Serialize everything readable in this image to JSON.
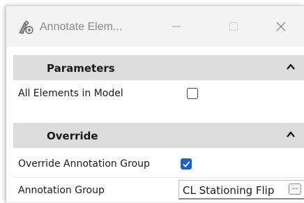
{
  "window": {
    "title": "Annotate Elem...",
    "app_icon": "annotate-tool-icon",
    "controls": {
      "minimize_icon": "minimize-icon",
      "maximize_icon": "maximize-icon",
      "close_icon": "close-icon"
    }
  },
  "sections": {
    "parameters": {
      "title": "Parameters",
      "collapse_icon": "chevron-up-icon",
      "rows": {
        "all_elements": {
          "label": "All Elements in Model",
          "checked": false
        }
      }
    },
    "override": {
      "title": "Override",
      "collapse_icon": "chevron-up-icon",
      "rows": {
        "override_group": {
          "label": "Override Annotation Group",
          "checked": true
        },
        "annotation_group": {
          "label": "Annotation Group",
          "value": "CL Stationing Flip",
          "browse_label": "..."
        }
      }
    }
  },
  "colors": {
    "accent": "#1a62c9",
    "section_header_bg": "#dcdcdc",
    "titlebar_bg": "#f3f3f3"
  }
}
